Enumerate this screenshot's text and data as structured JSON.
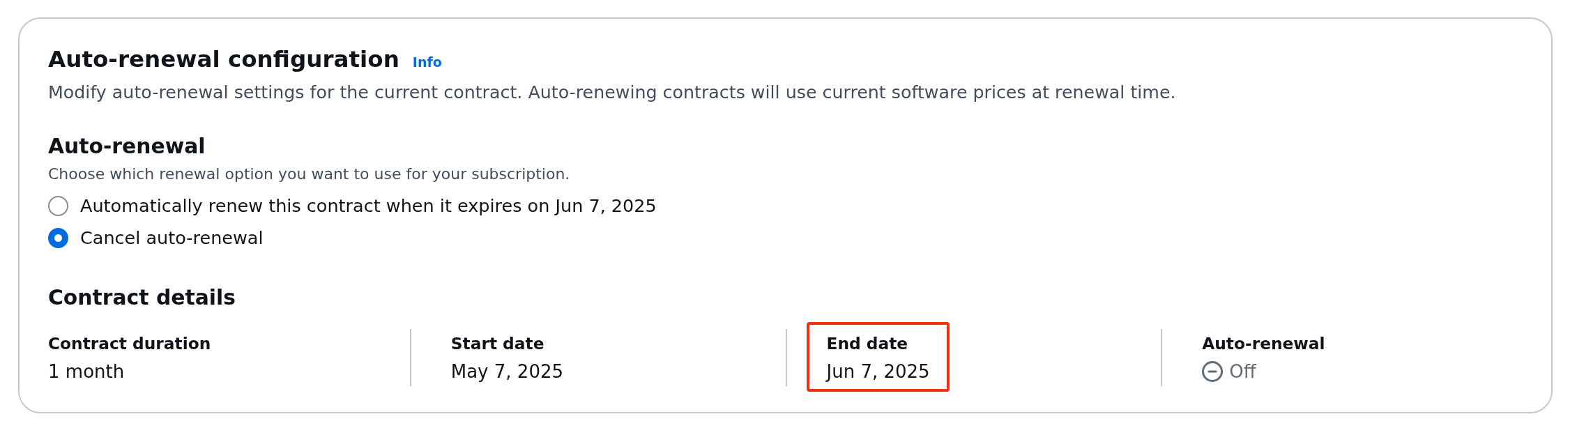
{
  "container": {
    "title": "Auto-renewal configuration",
    "info_link": "Info",
    "description": "Modify auto-renewal settings for the current contract. Auto-renewing contracts will use current software prices at renewal time."
  },
  "auto_renewal": {
    "title": "Auto-renewal",
    "description": "Choose which renewal option you want to use for your subscription.",
    "options": [
      {
        "label": "Automatically renew this contract when it expires on Jun 7, 2025",
        "selected": false
      },
      {
        "label": "Cancel auto-renewal",
        "selected": true
      }
    ]
  },
  "contract_details": {
    "title": "Contract details",
    "items": [
      {
        "kind": "text",
        "label": "Contract duration",
        "value": "1 month",
        "highlighted": false
      },
      {
        "kind": "text",
        "label": "Start date",
        "value": "May 7, 2025",
        "highlighted": false
      },
      {
        "kind": "text",
        "label": "End date",
        "value": "Jun 7, 2025",
        "highlighted": true
      },
      {
        "kind": "status",
        "label": "Auto-renewal",
        "value": "Off",
        "highlighted": false
      }
    ]
  }
}
